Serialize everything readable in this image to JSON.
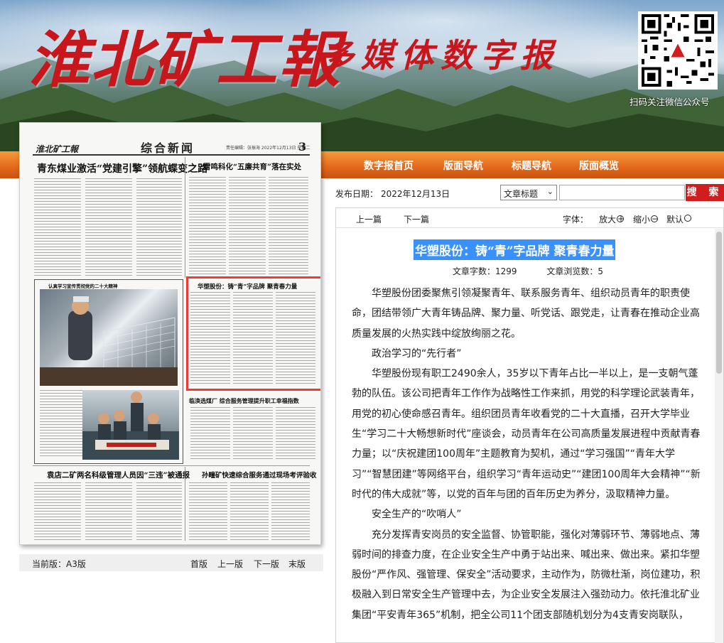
{
  "banner": {
    "masthead": "淮北矿工報",
    "subtitle": "多媒体数字报",
    "qr_caption": "扫码关注微信公众号"
  },
  "nav": {
    "items": [
      "数字报首页",
      "版面导航",
      "标题导航",
      "版面概览"
    ]
  },
  "newspaper": {
    "logo": "淮北矿工報",
    "section": "综合新闻",
    "meta": "责任编辑：张振海   2022年12月13日 星期二",
    "page_no": "3",
    "headlines": {
      "h1": "青东煤业激活“党建引擎”领航蝶变之路",
      "h2": "雷鸣科化“五廉共育”落在实处",
      "h3": "华塑股份：铸“青”字品牌 聚青春力量",
      "h4": "临涣选煤厂 综合服务管理提升职工幸福指数",
      "h5": "袁店二矿两名科级管理人员因“三违”被通报",
      "h6": "孙疃矿快速综合服务通过现场考评验收"
    },
    "photo_caption": "认真学习宣传贯彻党的二十大精神"
  },
  "page_nav": {
    "current": "当前版：A3版",
    "links": [
      "首版",
      "上一版",
      "下一版",
      "末版"
    ]
  },
  "search": {
    "date_label": "发布日期：",
    "date": "2022年12月13日",
    "select_value": "文章标题",
    "input_value": "",
    "button": "搜 索"
  },
  "article": {
    "prev": "上一篇",
    "next": "下一篇",
    "font_label": "字体：",
    "zoom_in": "放大",
    "zoom_out": "缩小",
    "default": "默认",
    "title": "华塑股份：铸“青”字品牌 聚青春力量",
    "word_count_label": "文章字数：",
    "word_count": "1299",
    "views_label": "文章浏览数：",
    "views": "5",
    "paragraphs": [
      "华塑股份团委聚焦引领凝聚青年、联系服务青年、组织动员青年的职责使命，团结带领广大青年铸品牌、聚力量、听党话、跟党走，让青春在推动企业高质量发展的火热实践中绽放绚丽之花。",
      "政治学习的“先行者”",
      "华塑股份现有职工2490余人，35岁以下青年占比一半以上，是一支朝气蓬勃的队伍。该公司把青年工作作为战略性工作来抓，用党的科学理论武装青年，用党的初心使命感召青年。组织团员青年收看党的二十大直播，召开大学毕业生“学习二十大畅想新时代”座谈会，动员青年在公司高质量发展进程中贡献青春力量；以“庆祝建团100周年”主题教育为契机，通过“学习强国”“青年大学习”“智慧团建”等网络平台，组织学习“青年运动史”“建团100周年大会精神”“新时代的伟大成就”等，以党的百年与团的百年历史为养分，汲取精神力量。",
      "安全生产的“吹哨人”",
      "充分发挥青安岗员的安全监督、协管职能，强化对薄弱环节、薄弱地点、薄弱时间的排查力度，在企业安全生产中勇于站出来、喊出来、做出来。紧扣华塑股份“严作风、强管理、保安全”活动要求，主动作为，防微杜渐，岗位建功，积极融入到日常安全生产管理中去，为企业安全发展注入强劲动力。依托淮北矿业集团“平安青年365”机制，把全公司11个团支部随机划分为4支青安岗联队，"
    ]
  }
}
